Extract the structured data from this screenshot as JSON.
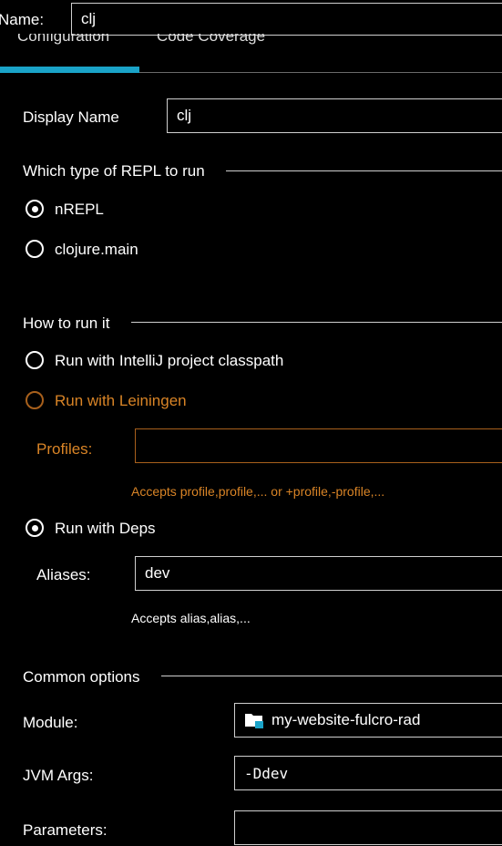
{
  "name_label": "Name:",
  "name_value": "clj",
  "tabs": [
    {
      "label": "Configuration",
      "selected": true
    },
    {
      "label": "Code Coverage",
      "selected": false
    }
  ],
  "display_name": {
    "label": "Display Name",
    "value": "clj"
  },
  "repl_type": {
    "title": "Which type of REPL to run",
    "options": [
      {
        "label": "nREPL",
        "checked": true
      },
      {
        "label": "clojure.main",
        "checked": false
      }
    ]
  },
  "how_to_run": {
    "title": "How to run it",
    "options": [
      {
        "label": "Run with IntelliJ project classpath",
        "checked": false,
        "enabled": true
      },
      {
        "label": "Run with Leiningen",
        "checked": false,
        "enabled": false
      },
      {
        "label": "Run with Deps",
        "checked": true,
        "enabled": true
      }
    ],
    "profiles": {
      "label": "Profiles:",
      "value": "",
      "hint": "Accepts profile,profile,... or +profile,-profile,..."
    },
    "aliases": {
      "label": "Aliases:",
      "value": "dev",
      "hint": "Accepts alias,alias,..."
    }
  },
  "common_options": {
    "title": "Common options",
    "module": {
      "label": "Module:",
      "value": "my-website-fulcro-rad",
      "icon": "module-folder-icon"
    },
    "jvm_args": {
      "label": "JVM Args:",
      "value": "-Ddev"
    },
    "parameters": {
      "label": "Parameters:",
      "value": ""
    }
  },
  "colors": {
    "background": "#000000",
    "accent": "#1aa3c8",
    "disabled": "#d98426",
    "border": "#cfcfcf"
  }
}
